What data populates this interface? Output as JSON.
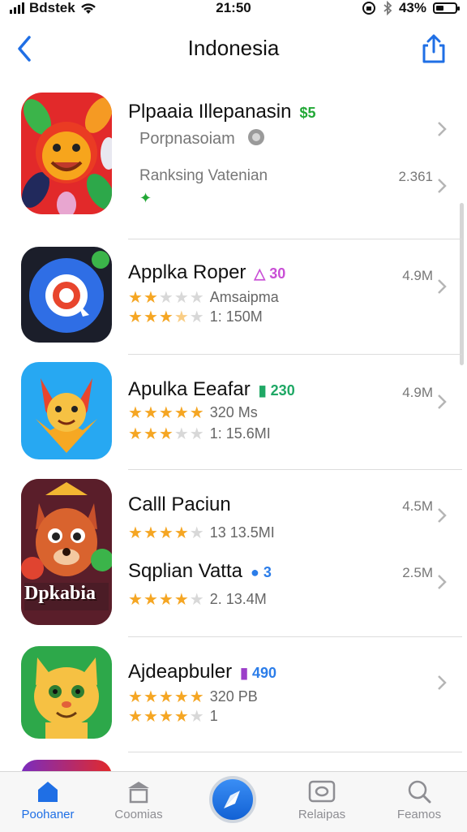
{
  "status_bar": {
    "carrier": "Bdstek",
    "time": "21:50",
    "battery": "43%",
    "battery_level": 0.43
  },
  "header": {
    "title": "Indonesia",
    "back_icon": "chevron-left-icon",
    "share_icon": "share-icon"
  },
  "apps": [
    {
      "name": "Plpaaia Illepanasin",
      "badge": "$5",
      "badge_color": "#22a836",
      "subtitle": "Porpnasoiam",
      "ranking_label": "Ranksing Vatenian",
      "size": "2.361",
      "rating": 0,
      "rating_text": ""
    },
    {
      "name": "Applka Roper",
      "badge": "30",
      "badge_color": "#c94fd6",
      "meta1_text": "Amsaipma",
      "meta1_rating": 2,
      "rating": 3.5,
      "rating_text": "1:  150M",
      "size": "4.9M"
    },
    {
      "name": "Apulka Eeafar",
      "badge": "230",
      "badge_color": "#1fa865",
      "meta1_text": "320 Ms",
      "meta1_rating": 5,
      "rating": 3,
      "rating_text": "1:  15.6MI",
      "size": "4.9M"
    },
    {
      "name": "Calll Paciun",
      "badge": "",
      "badge_color": "#111111",
      "rating": 4,
      "rating_text": "13  13.5MI",
      "size": "4.5M"
    },
    {
      "name": "Sqplian Vatta",
      "badge": "3",
      "badge_color": "#2b7de9",
      "rating": 4,
      "rating_text": "2.  13.4M",
      "size": "2.5M"
    },
    {
      "name": "Ajdeapbuler",
      "badge": "490",
      "badge_color": "#2b7de9",
      "meta1_text": "320 PB",
      "meta1_rating": 5,
      "rating": 4,
      "rating_text": "1",
      "size": ""
    }
  ],
  "icon_overlay_text": "Dpkabia",
  "tabs": [
    {
      "label": "Poohaner",
      "icon": "home-icon",
      "active": true
    },
    {
      "label": "Coomias",
      "icon": "store-icon",
      "active": false
    },
    {
      "label": "",
      "icon": "compass-icon",
      "active": false
    },
    {
      "label": "Relaipas",
      "icon": "gamepad-icon",
      "active": false
    },
    {
      "label": "Feamos",
      "icon": "search-icon",
      "active": false
    }
  ],
  "colors": {
    "accent": "#1f6fe5",
    "star": "#f5a623",
    "star_off": "#d8d8d8"
  }
}
